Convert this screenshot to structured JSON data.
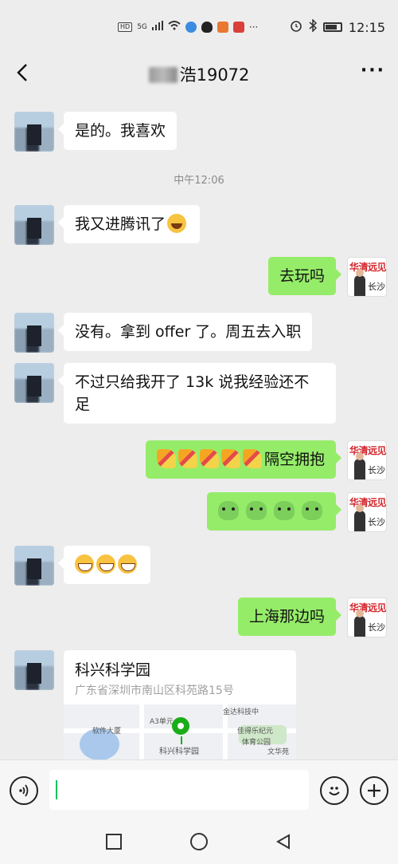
{
  "status_bar": {
    "left_labels": [
      "HD",
      "5G"
    ],
    "time": "12:15",
    "icons": [
      "signal-icon",
      "wifi-icon",
      "app-icon",
      "penguin-icon",
      "game-icon",
      "app-icon",
      "more-dots-icon",
      "alarm-icon",
      "bluetooth-icon",
      "battery-icon"
    ]
  },
  "header": {
    "title": "浩19072",
    "back_icon": "chevron-left-icon",
    "more_icon": "more-dots-icon"
  },
  "messages": [
    {
      "side": "in",
      "text": "是的。我喜欢"
    },
    {
      "type": "time",
      "text": "中午12:06"
    },
    {
      "side": "in",
      "text": "我又进腾讯了",
      "emoji": "laughing-tears-emoji"
    },
    {
      "side": "out",
      "text": "去玩吗"
    },
    {
      "side": "in",
      "text": "没有。拿到 offer 了。周五去入职"
    },
    {
      "side": "in",
      "line1": "不过只给我开了 13k 说我经验还不",
      "line2": "足"
    },
    {
      "side": "out",
      "text": "隔空拥抱",
      "emoji": "party-popper-emoji",
      "emoji_count": 5
    },
    {
      "side": "out",
      "emoji": "frog-emoji",
      "emoji_count": 4
    },
    {
      "side": "in",
      "emoji": "grin-emoji",
      "emoji_count": 3
    },
    {
      "side": "out",
      "text": "上海那边吗"
    }
  ],
  "self_avatar": {
    "brand": "华清远见",
    "sub": "长沙"
  },
  "location_card": {
    "title": "科兴科学园",
    "address": "广东省深圳市南山区科苑路15号",
    "map_labels": {
      "a": "金达科技中",
      "b": "A3单元",
      "c": "软件大厦",
      "d": "佳得乐纪元",
      "e": "体育公园",
      "f": "文华苑",
      "g": "科兴科学园"
    }
  },
  "input_bar": {
    "voice_icon": "voice-icon",
    "emoji_icon": "smiley-icon",
    "plus_icon": "plus-icon",
    "value": ""
  },
  "nav_bar": {
    "icons": [
      "recent-apps-icon",
      "home-icon",
      "back-icon"
    ]
  },
  "colors": {
    "outgoing": "#95ec69",
    "incoming": "#ffffff",
    "background": "#ededed",
    "accent": "#07c160"
  }
}
